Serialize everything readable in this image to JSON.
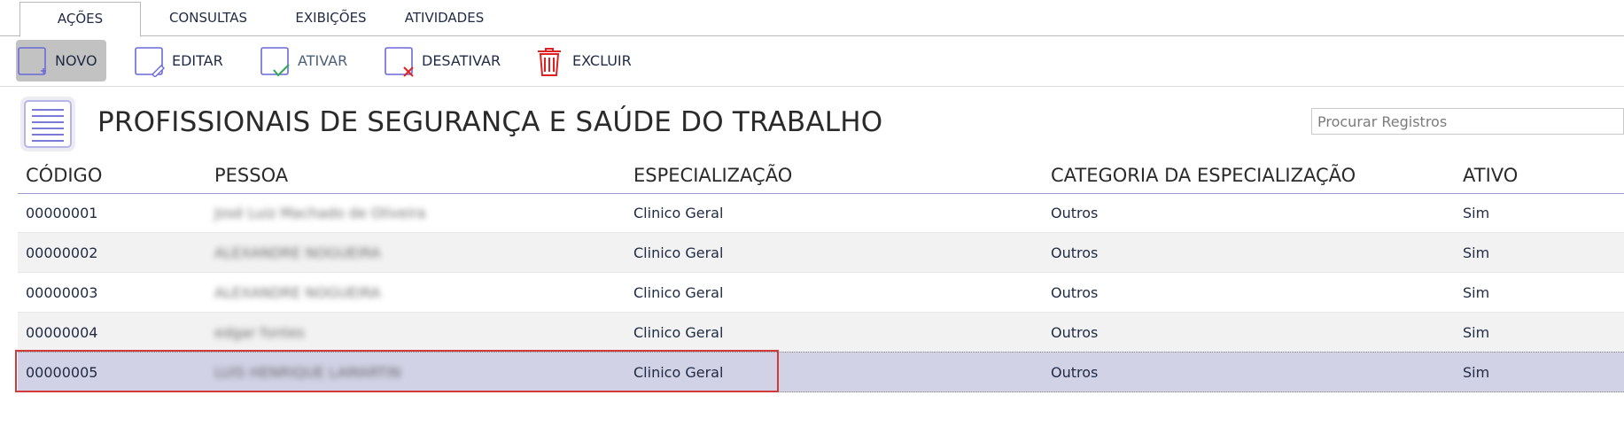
{
  "tabs": [
    "AÇÕES",
    "CONSULTAS",
    "EXIBIÇÕES",
    "ATIVIDADES"
  ],
  "toolbar": {
    "novo": "NOVO",
    "editar": "EDITAR",
    "ativar": "ATIVAR",
    "desativar": "DESATIVAR",
    "excluir": "EXCLUIR"
  },
  "icons": {
    "novo": "new-document-icon",
    "editar": "edit-pencil-icon",
    "ativar": "check-icon",
    "desativar": "x-icon",
    "excluir": "trash-icon",
    "page": "list-document-icon"
  },
  "colors": {
    "accent": "#6a6ad8",
    "delete": "#e02020",
    "check": "#2fa84f",
    "selected_row": "#d2d2e6"
  },
  "page": {
    "title": "PROFISSIONAIS DE SEGURANÇA E SAÚDE DO TRABALHO"
  },
  "search": {
    "placeholder": "Procurar Registros",
    "value": ""
  },
  "table": {
    "headers": [
      "CÓDIGO",
      "PESSOA",
      "ESPECIALIZAÇÃO",
      "CATEGORIA DA ESPECIALIZAÇÃO",
      "ATIVO"
    ],
    "rows": [
      [
        "00000001",
        "José Luiz Machado de Oliveira",
        "Clinico Geral",
        "Outros",
        "Sim"
      ],
      [
        "00000002",
        "ALEXANDRE NOGUEIRA",
        "Clinico Geral",
        "Outros",
        "Sim"
      ],
      [
        "00000003",
        "ALEXANDRE NOGUEIRA",
        "Clinico Geral",
        "Outros",
        "Sim"
      ],
      [
        "00000004",
        "edgar fontes",
        "Clinico Geral",
        "Outros",
        "Sim"
      ],
      [
        "00000005",
        "LUIS HENRIQUE LAMARTIN",
        "Clinico Geral",
        "Outros",
        "Sim"
      ]
    ]
  }
}
